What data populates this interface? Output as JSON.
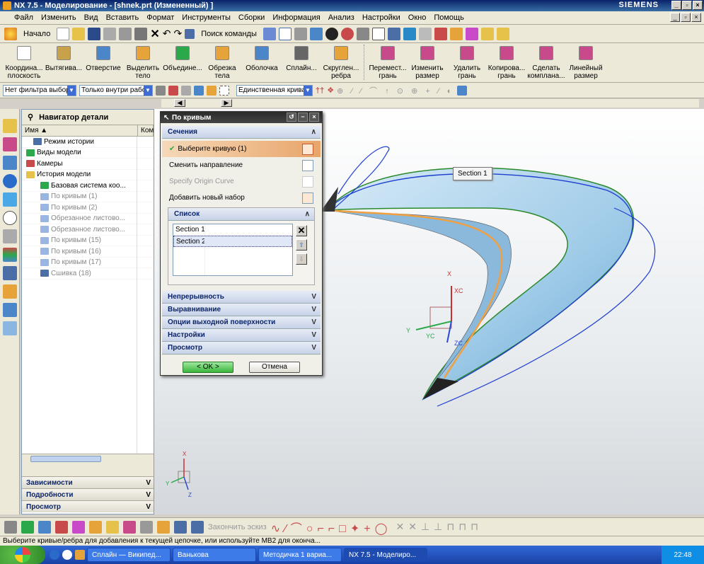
{
  "window": {
    "title": "NX 7.5 - Моделирование - [shnek.prt (Измененный) ]",
    "brand": "SIEMENS"
  },
  "menu": [
    "Файл",
    "Изменить",
    "Вид",
    "Вставить",
    "Формат",
    "Инструменты",
    "Сборки",
    "Информация",
    "Анализ",
    "Настройки",
    "Окно",
    "Помощь"
  ],
  "toolbar1": {
    "start_label": "Начало",
    "find_label": "Поиск команды"
  },
  "toolbar2": [
    {
      "label": "Координа... плоскость",
      "icon": "datum-plane-icon",
      "color": "#ffffff"
    },
    {
      "label": "Вытягива...",
      "icon": "extrude-icon",
      "color": "#c8a24a"
    },
    {
      "label": "Отверстие",
      "icon": "hole-icon",
      "color": "#4a86c8"
    },
    {
      "label": "Выделить тело",
      "icon": "extract-body-icon",
      "color": "#e6a33a"
    },
    {
      "label": "Объедине...",
      "icon": "unite-icon",
      "color": "#2aa84a"
    },
    {
      "label": "Обрезка тела",
      "icon": "trim-body-icon",
      "color": "#e6a33a"
    },
    {
      "label": "Оболочка",
      "icon": "shell-icon",
      "color": "#4a86c8"
    },
    {
      "label": "Сплайн...",
      "icon": "spline-icon",
      "color": "#666666"
    },
    {
      "label": "Скруглен... ребра",
      "icon": "edge-blend-icon",
      "color": "#e6a33a"
    },
    {
      "label": "Перемест... грань",
      "icon": "move-face-icon",
      "color": "#c84a8a"
    },
    {
      "label": "Изменить размер",
      "icon": "resize-icon",
      "color": "#c84a8a"
    },
    {
      "label": "Удалить грань",
      "icon": "delete-face-icon",
      "color": "#c84a8a"
    },
    {
      "label": "Копирова... грань",
      "icon": "copy-face-icon",
      "color": "#c84a8a"
    },
    {
      "label": "Сделать компланa...",
      "icon": "coplanar-icon",
      "color": "#c84a8a"
    },
    {
      "label": "Линейный размер",
      "icon": "linear-dim-icon",
      "color": "#c84a8a"
    }
  ],
  "toolbar3": {
    "filter": "Нет фильтра выбор",
    "scope": "Только внутри рабо",
    "curve_rule": "Единственная кривая"
  },
  "navigator": {
    "title": "Навигатор детали",
    "col_name": "Имя",
    "col_comment": "Ком",
    "items": [
      {
        "label": "Режим истории",
        "indent": 1,
        "dim": false,
        "icon_color": "#4a6ea5"
      },
      {
        "label": "Виды модели",
        "indent": 0,
        "dim": false,
        "icon_color": "#2aa84a"
      },
      {
        "label": "Камеры",
        "indent": 0,
        "dim": false,
        "icon_color": "#c84a4a"
      },
      {
        "label": "История модели",
        "indent": 0,
        "dim": false,
        "icon_color": "#e6c24a"
      },
      {
        "label": "Базовая система коо...",
        "indent": 2,
        "dim": false,
        "icon_color": "#2aa84a"
      },
      {
        "label": "По кривым (1)",
        "indent": 2,
        "dim": true,
        "icon_color": "#9ab6e0"
      },
      {
        "label": "По кривым (2)",
        "indent": 2,
        "dim": true,
        "icon_color": "#9ab6e0"
      },
      {
        "label": "Обрезанное листово...",
        "indent": 2,
        "dim": true,
        "icon_color": "#9ab6e0"
      },
      {
        "label": "Обрезанное листово...",
        "indent": 2,
        "dim": true,
        "icon_color": "#9ab6e0"
      },
      {
        "label": "По кривым (15)",
        "indent": 2,
        "dim": true,
        "icon_color": "#9ab6e0"
      },
      {
        "label": "По кривым (16)",
        "indent": 2,
        "dim": true,
        "icon_color": "#9ab6e0"
      },
      {
        "label": "По кривым (17)",
        "indent": 2,
        "dim": true,
        "icon_color": "#9ab6e0"
      },
      {
        "label": "Сшивка (18)",
        "indent": 2,
        "dim": true,
        "icon_color": "#4a6ea5"
      }
    ],
    "sections": [
      "Зависимости",
      "Подробности",
      "Просмотр"
    ]
  },
  "dialog": {
    "title": "По кривым",
    "section_sections": "Сечения",
    "select_curve": "Выберите кривую (1)",
    "reverse": "Сменить направление",
    "origin": "Specify Origin Curve",
    "add_set": "Добавить новый набор",
    "list_title": "Список",
    "list": [
      "Section  1",
      "Section  2"
    ],
    "collapsed": [
      "Непрерывность",
      "Выравнивание",
      "Опции выходной поверхности",
      "Настройки",
      "Просмотр"
    ],
    "ok": "< OK >",
    "cancel": "Отмена"
  },
  "viewport": {
    "tooltip": "Section  1",
    "axes": {
      "x": "X",
      "xc": "XC",
      "y": "Y",
      "yc": "YC",
      "zc": "ZC",
      "z": "Z"
    }
  },
  "toolbar4": {
    "finish_sketch": "Закончить эскиз"
  },
  "status": "Выберите кривые/ребра для добавления к текущей цепочке, или используйте MB2 для оконча...",
  "taskbar": {
    "tasks": [
      "Сплайн — Википед...",
      "Ванькова",
      "Методичка 1 вариа...",
      "NX 7.5 - Моделиро..."
    ],
    "clock": "22:48"
  }
}
